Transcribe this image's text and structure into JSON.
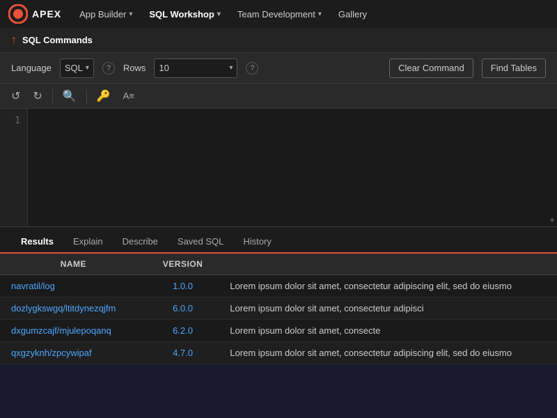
{
  "app": {
    "logo_text": "APEX",
    "nav_items": [
      {
        "label": "App Builder",
        "has_chevron": true,
        "active": false
      },
      {
        "label": "SQL Workshop",
        "has_chevron": true,
        "active": true
      },
      {
        "label": "Team Development",
        "has_chevron": true,
        "active": false
      },
      {
        "label": "Gallery",
        "has_chevron": false,
        "active": false
      }
    ]
  },
  "breadcrumb": {
    "icon": "↑",
    "text": "SQL Commands"
  },
  "toolbar": {
    "language_label": "Language",
    "language_value": "SQL",
    "rows_label": "Rows",
    "rows_value": "10",
    "clear_command_label": "Clear Command",
    "find_tables_label": "Find Tables"
  },
  "editor": {
    "line_numbers": [
      "1"
    ],
    "code_content": ""
  },
  "tabs": [
    {
      "label": "Results",
      "active": true
    },
    {
      "label": "Explain",
      "active": false
    },
    {
      "label": "Describe",
      "active": false
    },
    {
      "label": "Saved SQL",
      "active": false
    },
    {
      "label": "History",
      "active": false
    }
  ],
  "table": {
    "columns": [
      "NAME",
      "VERSION",
      ""
    ],
    "rows": [
      {
        "name": "navratil/log",
        "version": "1.0.0",
        "desc": "Lorem ipsum dolor sit amet, consectetur adipiscing elit, sed do eiusmo"
      },
      {
        "name": "dozlygkswgq/ltitdynezqjfm",
        "version": "6.0.0",
        "desc": "Lorem ipsum dolor sit amet, consectetur adipisci"
      },
      {
        "name": "dxgumzcajf/mjulepoqanq",
        "version": "6.2.0",
        "desc": "Lorem ipsum dolor sit amet, consecte"
      },
      {
        "name": "qxgzyknh/zpcywipaf",
        "version": "4.7.0",
        "desc": "Lorem ipsum dolor sit amet, consectetur adipiscing elit, sed do eiusmo"
      }
    ]
  }
}
